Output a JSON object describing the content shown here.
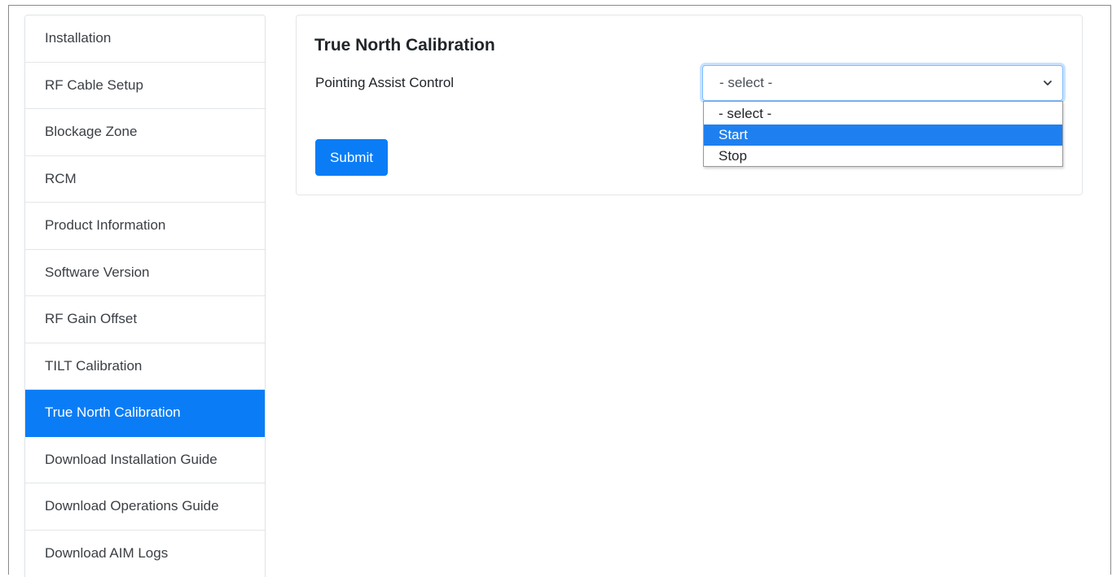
{
  "sidebar": {
    "items": [
      {
        "label": "Installation"
      },
      {
        "label": "RF Cable Setup"
      },
      {
        "label": "Blockage Zone"
      },
      {
        "label": "RCM"
      },
      {
        "label": "Product Information"
      },
      {
        "label": "Software Version"
      },
      {
        "label": "RF Gain Offset"
      },
      {
        "label": "TILT Calibration"
      },
      {
        "label": "True North Calibration"
      },
      {
        "label": "Download Installation Guide"
      },
      {
        "label": "Download Operations Guide"
      },
      {
        "label": "Download AIM Logs"
      }
    ],
    "active_index": 8
  },
  "main": {
    "title": "True North Calibration",
    "field_label": "Pointing Assist Control",
    "select": {
      "value": "- select -",
      "options": [
        "- select -",
        "Start",
        "Stop"
      ],
      "highlighted_index": 1
    },
    "submit_label": "Submit"
  },
  "colors": {
    "accent": "#0a7df6",
    "highlight": "#1e80f0",
    "focus_border": "#80bdff"
  },
  "icons": {
    "select_arrow": "chevron-down-icon"
  }
}
